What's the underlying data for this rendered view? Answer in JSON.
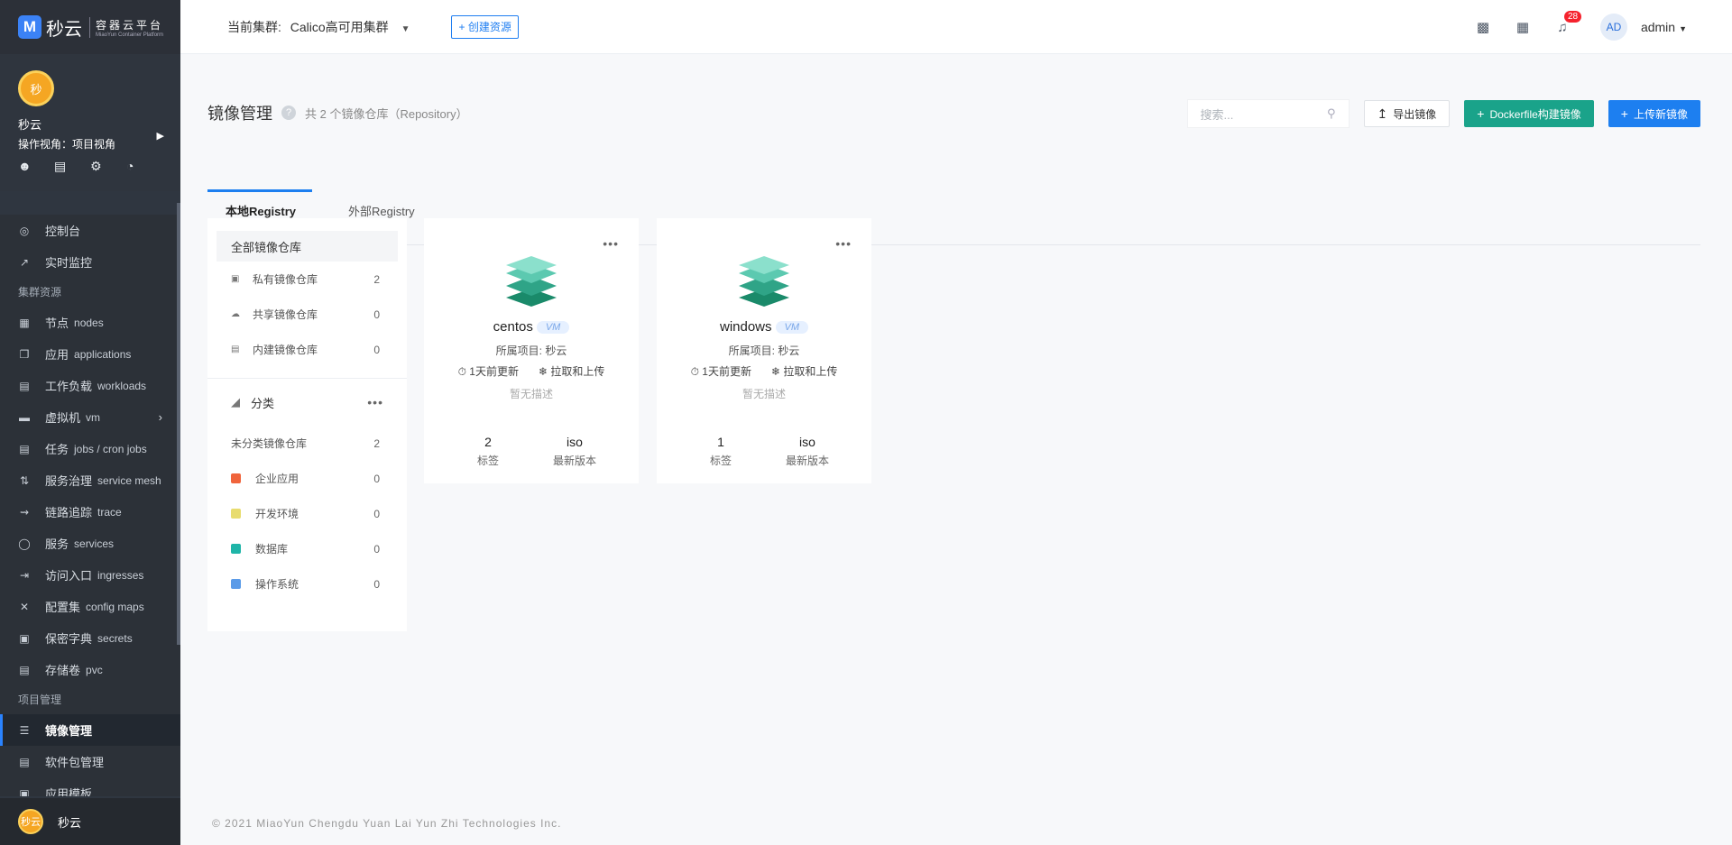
{
  "brand": {
    "logo_letter": "M",
    "name": "秒云",
    "subtitle": "容器云平台",
    "subtitle_en": "MiaoYun Container Platform"
  },
  "user_panel": {
    "avatar_text": "秒",
    "name": "秒云",
    "view": "操作视角：项目视角",
    "icons": [
      "user-icon",
      "chart-icon",
      "settings-icon",
      "pie-icon"
    ]
  },
  "nav": {
    "items": [
      {
        "label": "控制台",
        "en": "",
        "icon": "console-icon"
      },
      {
        "label": "实时监控",
        "en": "",
        "icon": "monitor-icon"
      },
      {
        "group": "集群资源"
      },
      {
        "label": "节点",
        "en": "nodes",
        "icon": "nodes-icon"
      },
      {
        "label": "应用",
        "en": "applications",
        "icon": "applications-icon"
      },
      {
        "label": "工作负载",
        "en": "workloads",
        "icon": "workloads-icon"
      },
      {
        "label": "虚拟机",
        "en": "vm",
        "icon": "vm-icon",
        "expandable": true
      },
      {
        "label": "任务",
        "en": "jobs / cron jobs",
        "icon": "jobs-icon"
      },
      {
        "label": "服务治理",
        "en": "service mesh",
        "icon": "service-mesh-icon"
      },
      {
        "label": "链路追踪",
        "en": "trace",
        "icon": "trace-icon"
      },
      {
        "label": "服务",
        "en": "services",
        "icon": "services-icon"
      },
      {
        "label": "访问入口",
        "en": "ingresses",
        "icon": "ingress-icon"
      },
      {
        "label": "配置集",
        "en": "config maps",
        "icon": "configmap-icon"
      },
      {
        "label": "保密字典",
        "en": "secrets",
        "icon": "secrets-icon"
      },
      {
        "label": "存储卷",
        "en": "pvc",
        "icon": "pvc-icon"
      },
      {
        "group": "项目管理"
      },
      {
        "label": "镜像管理",
        "en": "",
        "icon": "image-icon",
        "active": true
      },
      {
        "label": "软件包管理",
        "en": "",
        "icon": "package-icon"
      },
      {
        "label": "应用模板",
        "en": "",
        "icon": "template-icon"
      }
    ],
    "footer_avatar": "秒云",
    "footer_name": "秒云"
  },
  "topbar": {
    "cluster_label": "当前集群:",
    "cluster_name": "Calico高可用集群",
    "create_button": "+ 创建资源",
    "notification_count": "28",
    "avatar": "AD",
    "user": "admin"
  },
  "page": {
    "title": "镜像管理",
    "subtitle": "共 2 个镜像仓库（Repository）",
    "search_placeholder": "搜索...",
    "export_button": "导出镜像",
    "dockerfile_button": "Dockerfile构建镜像",
    "upload_button": "上传新镜像",
    "tabs": [
      "本地Registry",
      "外部Registry"
    ]
  },
  "categories": {
    "all": "全部镜像仓库",
    "repo_types": [
      {
        "label": "私有镜像仓库",
        "count": "2",
        "icon": "lock-icon"
      },
      {
        "label": "共享镜像仓库",
        "count": "0",
        "icon": "cloud-icon"
      },
      {
        "label": "内建镜像仓库",
        "count": "0",
        "icon": "builtin-icon"
      }
    ],
    "section_title": "分类",
    "uncategorized": {
      "label": "未分类镜像仓库",
      "count": "2"
    },
    "classes": [
      {
        "label": "企业应用",
        "count": "0",
        "color": "#f0643c"
      },
      {
        "label": "开发环境",
        "count": "0",
        "color": "#e8dc6e"
      },
      {
        "label": "数据库",
        "count": "0",
        "color": "#1fb5a8"
      },
      {
        "label": "操作系统",
        "count": "0",
        "color": "#5b9be8"
      }
    ]
  },
  "repos": [
    {
      "name": "centos",
      "tag": "VM",
      "project": "所属项目: 秒云",
      "updated": "1天前更新",
      "permission": "拉取和上传",
      "desc": "暂无描述",
      "tags_count": "2",
      "tags_label": "标签",
      "latest": "iso",
      "latest_label": "最新版本"
    },
    {
      "name": "windows",
      "tag": "VM",
      "project": "所属项目: 秒云",
      "updated": "1天前更新",
      "permission": "拉取和上传",
      "desc": "暂无描述",
      "tags_count": "1",
      "tags_label": "标签",
      "latest": "iso",
      "latest_label": "最新版本"
    }
  ],
  "footer": {
    "copyright": "© 2021 MiaoYun Chengdu Yuan Lai Yun Zhi Technologies Inc."
  }
}
